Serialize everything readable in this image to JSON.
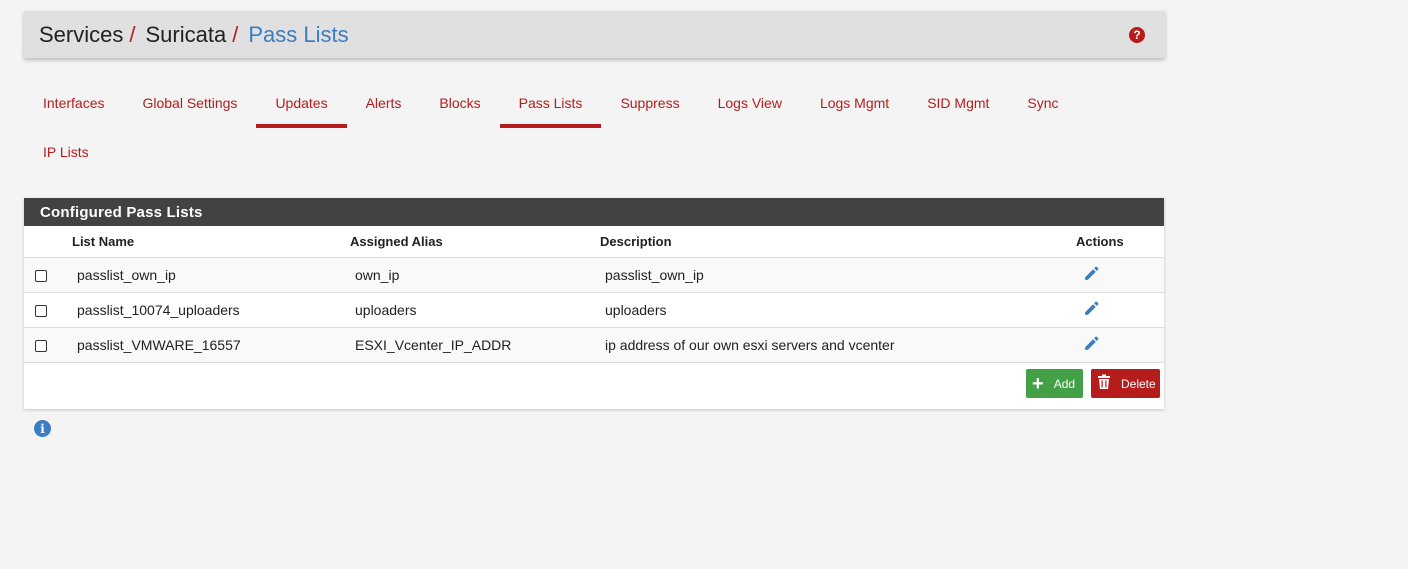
{
  "breadcrumb": {
    "items": [
      "Services",
      "Suricata",
      "Pass Lists"
    ],
    "separator": "/"
  },
  "tabs": {
    "row1": [
      "Interfaces",
      "Global Settings",
      "Updates",
      "Alerts",
      "Blocks",
      "Pass Lists",
      "Suppress",
      "Logs View",
      "Logs Mgmt",
      "SID Mgmt",
      "Sync"
    ],
    "row2": [
      "IP Lists"
    ],
    "active": "Pass Lists"
  },
  "panel": {
    "title": "Configured Pass Lists",
    "columns": [
      "List Name",
      "Assigned Alias",
      "Description",
      "Actions"
    ],
    "rows": [
      {
        "name": "passlist_own_ip",
        "alias": "own_ip",
        "description": "passlist_own_ip"
      },
      {
        "name": "passlist_10074_uploaders",
        "alias": "uploaders",
        "description": "uploaders"
      },
      {
        "name": "passlist_VMWARE_16557",
        "alias": "ESXI_Vcenter_IP_ADDR",
        "description": "ip address of our own esxi servers and vcenter"
      }
    ],
    "add_label": "Add",
    "delete_label": "Delete"
  },
  "icons": {
    "help": "question-circle-icon",
    "edit": "pencil-icon",
    "add": "plus-icon",
    "delete": "trash-icon",
    "info": "info-circle-icon"
  },
  "colors": {
    "accent_red": "#b71c1c",
    "link_blue": "#3a7dc0",
    "add_green": "#43a047",
    "panel_heading": "#424242"
  }
}
